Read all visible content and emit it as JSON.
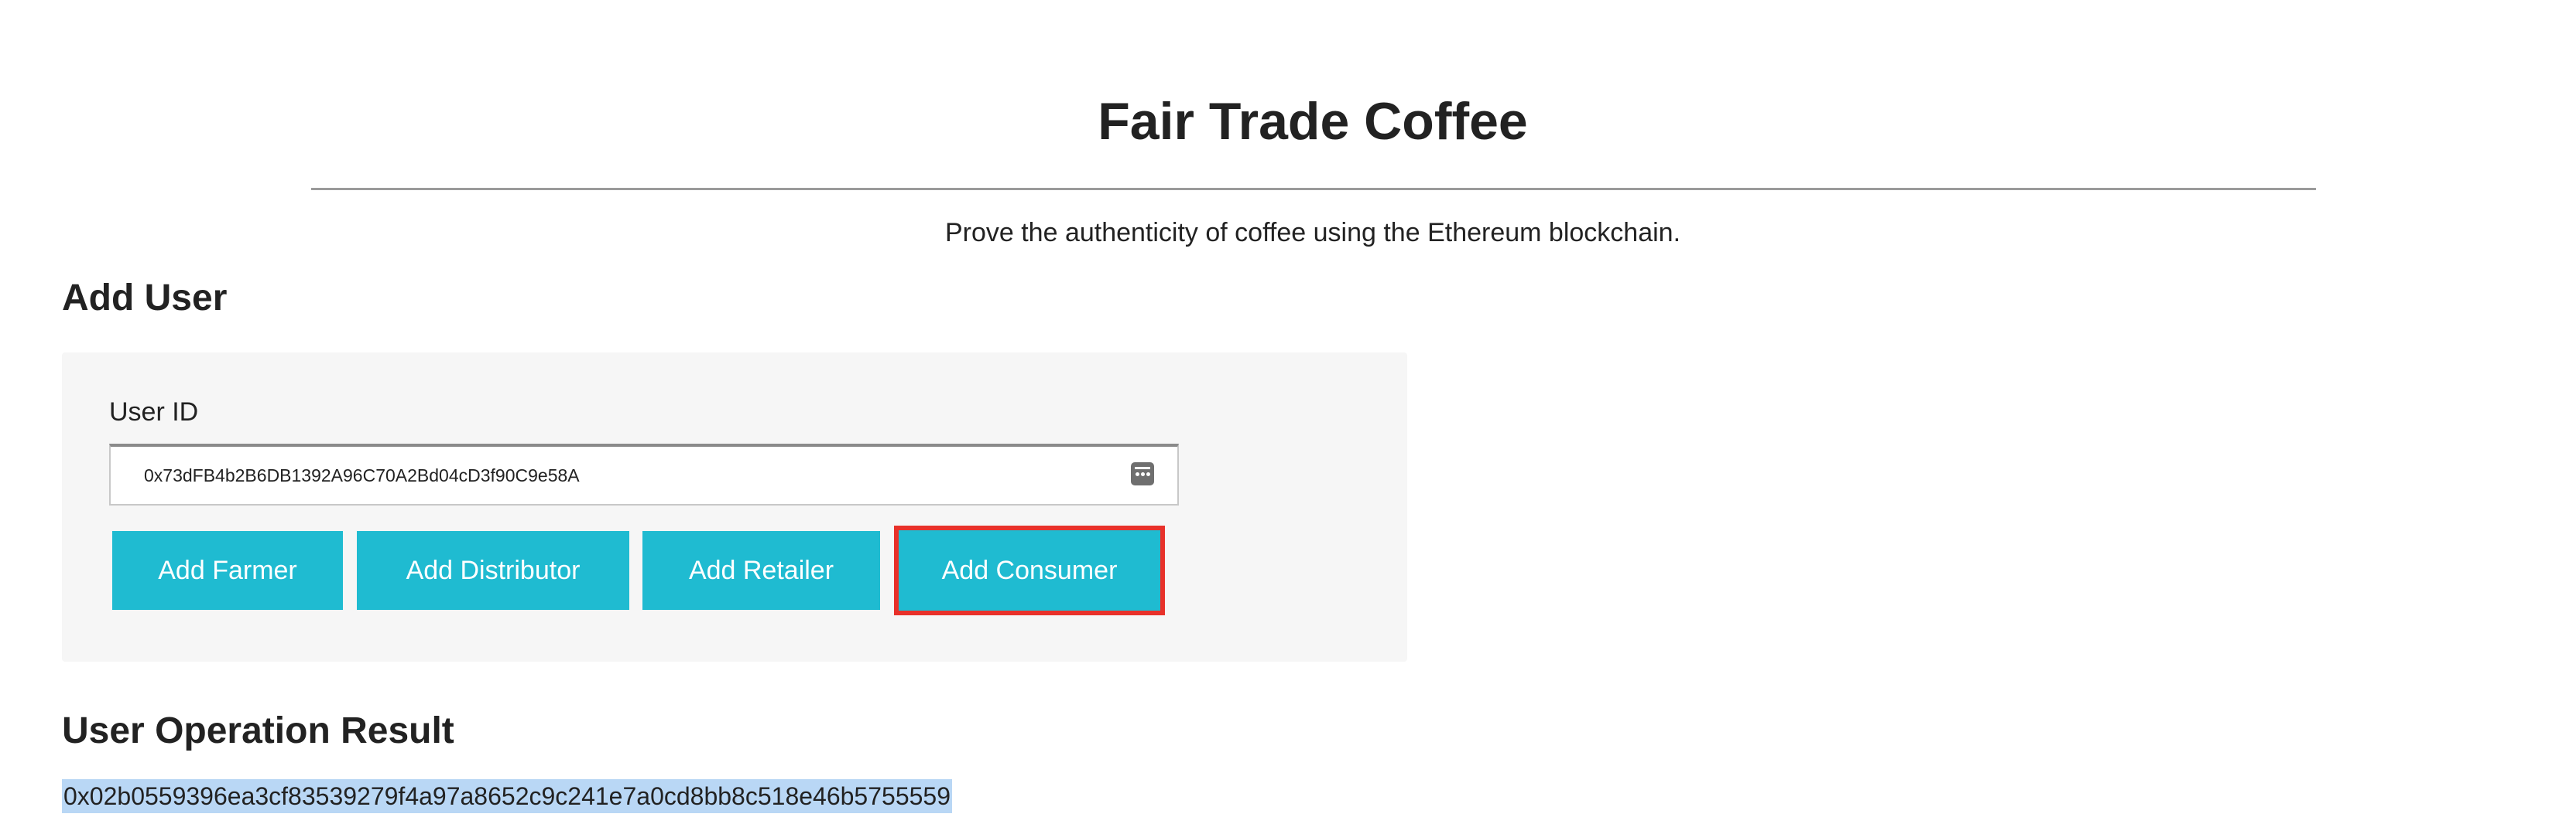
{
  "header": {
    "title": "Fair Trade Coffee",
    "subtitle": "Prove the authenticity of coffee using the Ethereum blockchain."
  },
  "add_user": {
    "heading": "Add User",
    "user_id_label": "User ID",
    "user_id_value": "0x73dFB4b2B6DB1392A96C70A2Bd04cD3f90C9e58A",
    "buttons": {
      "farmer": "Add Farmer",
      "distributor": "Add Distributor",
      "retailer": "Add Retailer",
      "consumer": "Add Consumer"
    },
    "highlighted_button": "consumer"
  },
  "result": {
    "heading": "User Operation Result",
    "value": "0x02b0559396ea3cf83539279f4a97a8652c9c241e7a0cd8bb8c518e46b5755559",
    "selected": true
  },
  "icons": {
    "input_accessory": "password-manager-key-icon"
  },
  "colors": {
    "button_bg": "#1fbbd1",
    "button_text": "#ffffff",
    "highlight_border": "#e8312a",
    "panel_bg": "#f6f6f6",
    "selection_bg": "#b9d7f5"
  }
}
